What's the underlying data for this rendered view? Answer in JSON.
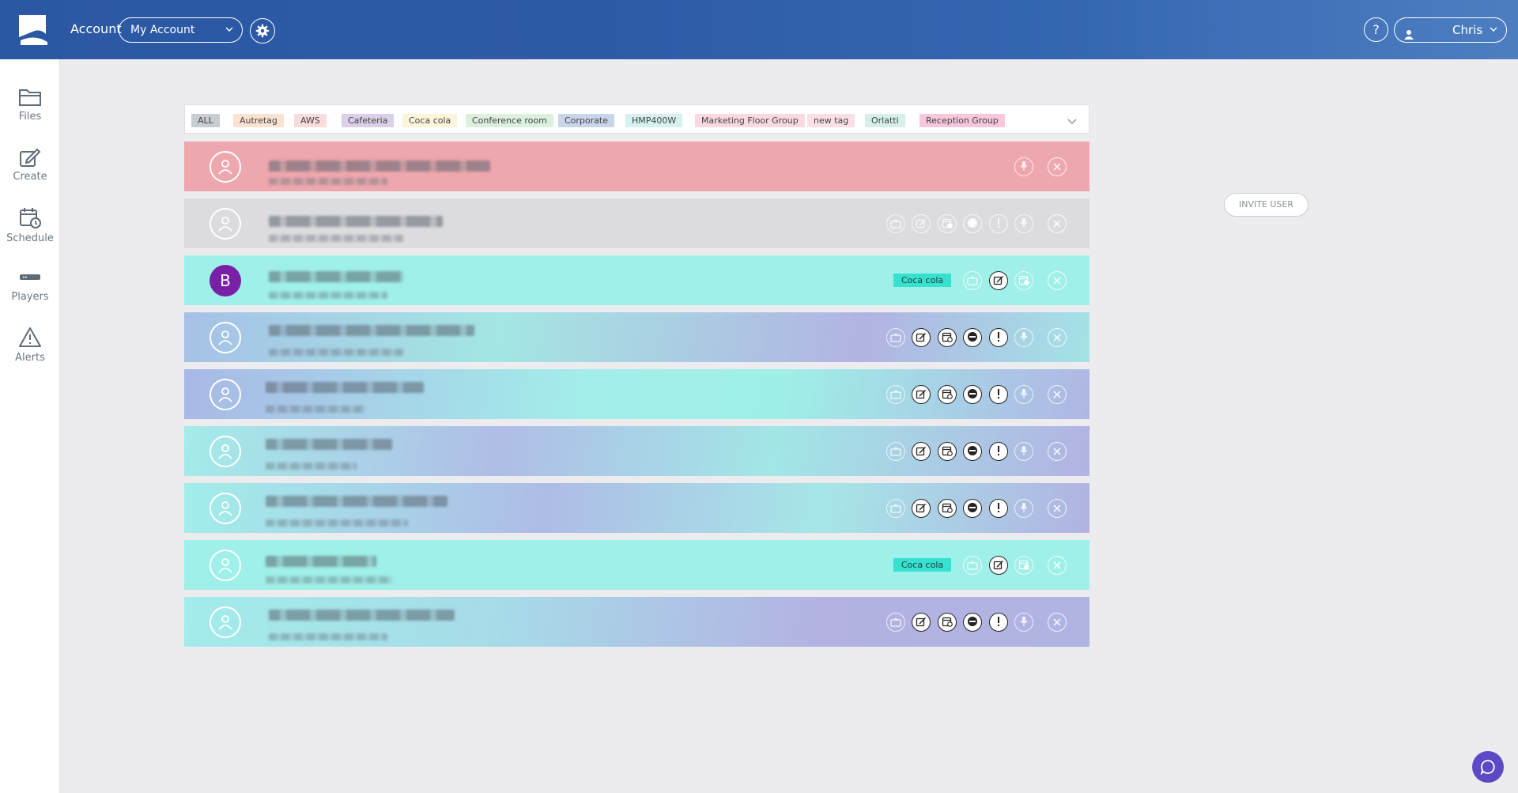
{
  "header": {
    "account_label": "Account",
    "account_select": "My Account",
    "help_label": "?",
    "user_name": "Chris"
  },
  "sidebar": {
    "items": [
      {
        "label": "Files",
        "icon": "folder-icon"
      },
      {
        "label": "Create",
        "icon": "edit-icon"
      },
      {
        "label": "Schedule",
        "icon": "calendar-clock-icon"
      },
      {
        "label": "Players",
        "icon": "player-device-icon"
      },
      {
        "label": "Alerts",
        "icon": "warning-icon"
      }
    ]
  },
  "tags": [
    {
      "label": "ALL",
      "color": "#c8ccd3"
    },
    {
      "label": "Autretag",
      "color": "#fbe2d3"
    },
    {
      "label": "AWS",
      "color": "#fadcdc"
    },
    {
      "label": "Cafeteria",
      "color": "#dccfe9"
    },
    {
      "label": "Coca cola",
      "color": "#fdf5d9"
    },
    {
      "label": "Conference room",
      "color": "#dbf1de"
    },
    {
      "label": "Corporate",
      "color": "#c9d6ea"
    },
    {
      "label": "HMP400W",
      "color": "#d5f2f0"
    },
    {
      "label": "Marketing Floor Group",
      "color": "#fbd9e1"
    },
    {
      "label": "new tag",
      "color": "#fbdfe6"
    },
    {
      "label": "Orlatti",
      "color": "#d4f0e8"
    },
    {
      "label": "Reception Group",
      "color": "#f7c8dd"
    }
  ],
  "rows": [
    {
      "style": "pink",
      "avatar": "",
      "tag": "",
      "buttons": [
        "mic-icon"
      ],
      "dim": [
        true
      ]
    },
    {
      "style": "gray",
      "avatar": "",
      "tag": "",
      "buttons": [
        "player-icon",
        "edit-icon",
        "schedule-icon",
        "minus-icon",
        "alert-icon",
        "mic-icon"
      ],
      "dim": [
        true,
        true,
        true,
        true,
        true,
        true
      ]
    },
    {
      "style": "cyan",
      "avatar": "B",
      "tag": "Coca cola",
      "buttons": [
        "player-icon",
        "edit-icon",
        "schedule-icon"
      ],
      "dim": [
        true,
        false,
        true
      ]
    },
    {
      "style": "mixed1",
      "avatar": "",
      "tag": "",
      "buttons": [
        "player-icon",
        "edit-icon",
        "schedule-icon",
        "minus-icon",
        "alert-icon",
        "mic-icon"
      ],
      "dim": [
        true,
        false,
        false,
        false,
        false,
        true
      ]
    },
    {
      "style": "mixed2",
      "avatar": "",
      "tag": "",
      "buttons": [
        "player-icon",
        "edit-icon",
        "schedule-icon",
        "minus-icon",
        "alert-icon",
        "mic-icon"
      ],
      "dim": [
        true,
        false,
        false,
        false,
        false,
        true
      ]
    },
    {
      "style": "mixed3",
      "avatar": "",
      "tag": "",
      "buttons": [
        "player-icon",
        "edit-icon",
        "schedule-icon",
        "minus-icon",
        "alert-icon",
        "mic-icon"
      ],
      "dim": [
        true,
        false,
        false,
        false,
        false,
        true
      ]
    },
    {
      "style": "mixed4",
      "avatar": "",
      "tag": "",
      "buttons": [
        "player-icon",
        "edit-icon",
        "schedule-icon",
        "minus-icon",
        "alert-icon",
        "mic-icon"
      ],
      "dim": [
        true,
        false,
        false,
        false,
        false,
        true
      ]
    },
    {
      "style": "cyan",
      "avatar": "",
      "tag": "Coca cola",
      "buttons": [
        "player-icon",
        "edit-icon",
        "schedule-icon"
      ],
      "dim": [
        true,
        false,
        true
      ]
    },
    {
      "style": "mixed5",
      "avatar": "",
      "tag": "",
      "buttons": [
        "player-icon",
        "edit-icon",
        "schedule-icon",
        "minus-icon",
        "alert-icon",
        "mic-icon"
      ],
      "dim": [
        true,
        false,
        false,
        false,
        false,
        true
      ]
    }
  ],
  "invite_label": "INVITE USER",
  "colors": {
    "header": "#2e5ba8",
    "row_pink": "#eea7ae",
    "row_gray": "#dcdcde",
    "row_cyan": "#9ff0e8",
    "tag_coca": "#36e1cf",
    "chat": "#5b49c6"
  }
}
